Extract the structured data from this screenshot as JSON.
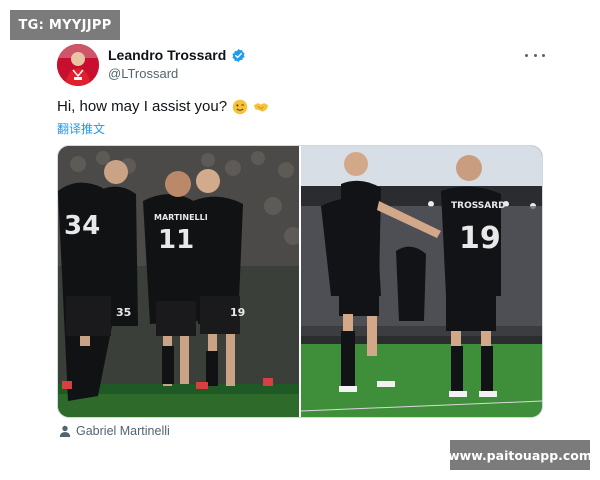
{
  "watermarks": {
    "top": "TG: MYYJJPP",
    "bottom": "www.paitouapp.com"
  },
  "tweet": {
    "author_name": "Leandro Trossard",
    "author_handle": "@LTrossard",
    "verified": true,
    "text": "Hi, how may I assist you?",
    "emojis": [
      "winking-face-emoji",
      "handshake-emoji"
    ],
    "translate_label": "翻译推文",
    "tagged_person": "Gabriel Martinelli",
    "images": [
      {
        "name": "photo-celebration-group",
        "jersey_numbers": [
          "34",
          "11",
          "19",
          "35"
        ],
        "jersey_text": [
          "MARTINELLI"
        ]
      },
      {
        "name": "photo-celebration-pair",
        "jersey_numbers": [
          "19"
        ],
        "jersey_text": [
          "TROSSARD"
        ]
      }
    ]
  },
  "colors": {
    "link": "#1d9bf0",
    "verified": "#1d9bf0",
    "secondary_text": "#536471",
    "watermark_bg": "#7b7b7b"
  }
}
